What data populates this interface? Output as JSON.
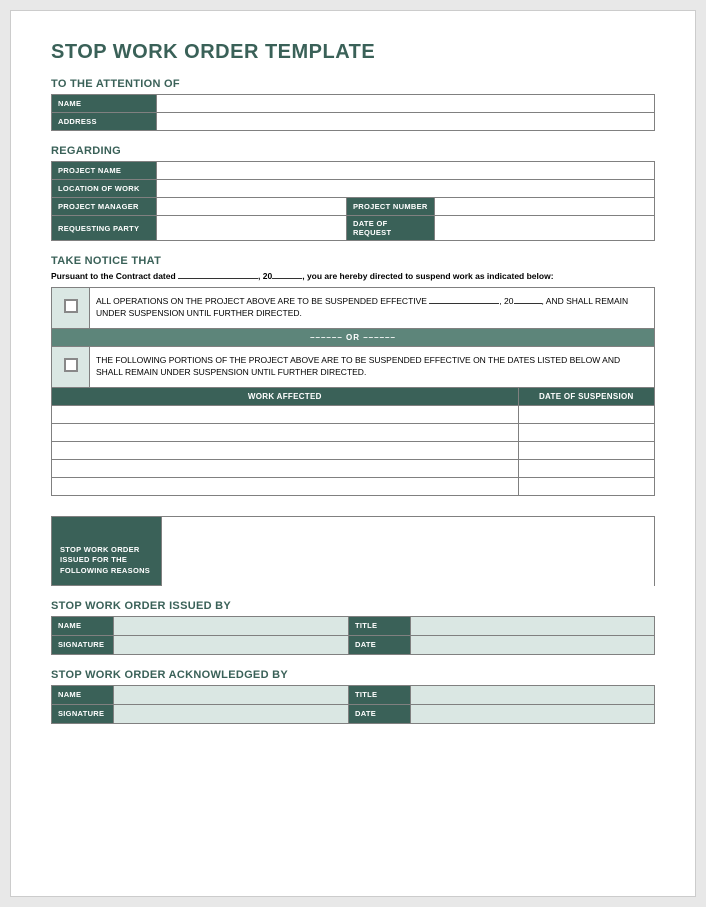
{
  "title": "STOP WORK ORDER TEMPLATE",
  "sections": {
    "attention": {
      "title": "TO THE ATTENTION OF",
      "name_label": "NAME",
      "address_label": "ADDRESS"
    },
    "regarding": {
      "title": "REGARDING",
      "project_name_label": "PROJECT NAME",
      "location_label": "LOCATION OF WORK",
      "manager_label": "PROJECT MANAGER",
      "number_label": "PROJECT NUMBER",
      "requesting_label": "REQUESTING PARTY",
      "date_request_label": "DATE OF REQUEST"
    },
    "notice": {
      "title": "TAKE NOTICE THAT",
      "pursuant_1": "Pursuant to the Contract dated ",
      "pursuant_2": ", 20",
      "pursuant_3": ", you are hereby directed to suspend work as indicated below:",
      "option1_a": "ALL OPERATIONS ON THE PROJECT ABOVE ARE TO BE SUSPENDED EFFECTIVE ",
      "option1_b": ", 20",
      "option1_c": ", AND SHALL REMAIN UNDER SUSPENSION UNTIL FURTHER DIRECTED.",
      "or_text": "––––––   OR   ––––––",
      "option2": "THE FOLLOWING PORTIONS OF THE PROJECT ABOVE ARE TO BE SUSPENDED EFFECTIVE ON THE DATES LISTED BELOW AND SHALL REMAIN UNDER SUSPENSION UNTIL FURTHER DIRECTED.",
      "work_affected_header": "WORK AFFECTED",
      "date_suspension_header": "DATE OF SUSPENSION"
    },
    "reasons": {
      "label": "STOP WORK ORDER ISSUED FOR THE FOLLOWING REASONS"
    },
    "issued_by": {
      "title": "STOP WORK ORDER ISSUED BY",
      "name_label": "NAME",
      "title_label": "TITLE",
      "signature_label": "SIGNATURE",
      "date_label": "DATE"
    },
    "acknowledged_by": {
      "title": "STOP WORK ORDER ACKNOWLEDGED BY",
      "name_label": "NAME",
      "title_label": "TITLE",
      "signature_label": "SIGNATURE",
      "date_label": "DATE"
    }
  }
}
